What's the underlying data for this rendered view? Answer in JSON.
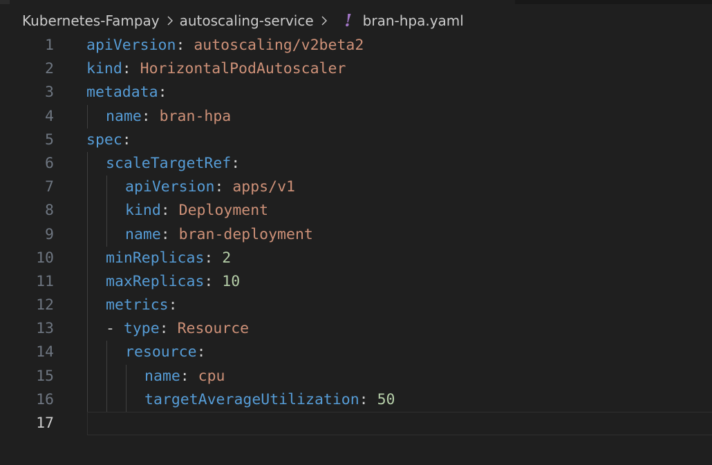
{
  "breadcrumb": {
    "folder": "Kubernetes-Fampay",
    "subfolder": "autoscaling-service",
    "file_icon": "yaml-exclamation-icon",
    "file_icon_glyph": "!",
    "file": "bran-hpa.yaml"
  },
  "editor": {
    "active_line": 17,
    "lines": [
      {
        "num": "1",
        "indent": 0,
        "tokens": [
          {
            "t": "k",
            "v": "apiVersion"
          },
          {
            "t": "p",
            "v": ": "
          },
          {
            "t": "s",
            "v": "autoscaling/v2beta2"
          }
        ]
      },
      {
        "num": "2",
        "indent": 0,
        "tokens": [
          {
            "t": "k",
            "v": "kind"
          },
          {
            "t": "p",
            "v": ": "
          },
          {
            "t": "s",
            "v": "HorizontalPodAutoscaler"
          }
        ]
      },
      {
        "num": "3",
        "indent": 0,
        "tokens": [
          {
            "t": "k",
            "v": "metadata"
          },
          {
            "t": "p",
            "v": ":"
          }
        ]
      },
      {
        "num": "4",
        "indent": 1,
        "tokens": [
          {
            "t": "k",
            "v": "name"
          },
          {
            "t": "p",
            "v": ": "
          },
          {
            "t": "s",
            "v": "bran-hpa"
          }
        ]
      },
      {
        "num": "5",
        "indent": 0,
        "tokens": [
          {
            "t": "k",
            "v": "spec"
          },
          {
            "t": "p",
            "v": ":"
          }
        ]
      },
      {
        "num": "6",
        "indent": 1,
        "tokens": [
          {
            "t": "k",
            "v": "scaleTargetRef"
          },
          {
            "t": "p",
            "v": ":"
          }
        ]
      },
      {
        "num": "7",
        "indent": 2,
        "tokens": [
          {
            "t": "k",
            "v": "apiVersion"
          },
          {
            "t": "p",
            "v": ": "
          },
          {
            "t": "s",
            "v": "apps/v1"
          }
        ]
      },
      {
        "num": "8",
        "indent": 2,
        "tokens": [
          {
            "t": "k",
            "v": "kind"
          },
          {
            "t": "p",
            "v": ": "
          },
          {
            "t": "s",
            "v": "Deployment"
          }
        ]
      },
      {
        "num": "9",
        "indent": 2,
        "tokens": [
          {
            "t": "k",
            "v": "name"
          },
          {
            "t": "p",
            "v": ": "
          },
          {
            "t": "s",
            "v": "bran-deployment"
          }
        ]
      },
      {
        "num": "10",
        "indent": 1,
        "tokens": [
          {
            "t": "k",
            "v": "minReplicas"
          },
          {
            "t": "p",
            "v": ": "
          },
          {
            "t": "n",
            "v": "2"
          }
        ]
      },
      {
        "num": "11",
        "indent": 1,
        "tokens": [
          {
            "t": "k",
            "v": "maxReplicas"
          },
          {
            "t": "p",
            "v": ": "
          },
          {
            "t": "n",
            "v": "10"
          }
        ]
      },
      {
        "num": "12",
        "indent": 1,
        "tokens": [
          {
            "t": "k",
            "v": "metrics"
          },
          {
            "t": "p",
            "v": ":"
          }
        ]
      },
      {
        "num": "13",
        "indent": 1,
        "tokens": [
          {
            "t": "p",
            "v": "- "
          },
          {
            "t": "k",
            "v": "type"
          },
          {
            "t": "p",
            "v": ": "
          },
          {
            "t": "s",
            "v": "Resource"
          }
        ]
      },
      {
        "num": "14",
        "indent": 2,
        "tokens": [
          {
            "t": "k",
            "v": "resource"
          },
          {
            "t": "p",
            "v": ":"
          }
        ]
      },
      {
        "num": "15",
        "indent": 3,
        "tokens": [
          {
            "t": "k",
            "v": "name"
          },
          {
            "t": "p",
            "v": ": "
          },
          {
            "t": "s",
            "v": "cpu"
          }
        ]
      },
      {
        "num": "16",
        "indent": 3,
        "tokens": [
          {
            "t": "k",
            "v": "targetAverageUtilization"
          },
          {
            "t": "p",
            "v": ": "
          },
          {
            "t": "n",
            "v": "50"
          }
        ]
      },
      {
        "num": "17",
        "indent": 0,
        "tokens": []
      }
    ]
  },
  "colors": {
    "background": "#1f1f1f",
    "key": "#569cd6",
    "string": "#ce9178",
    "number": "#b5cea8",
    "punctuation": "#cccccc",
    "line_number": "#6e7681",
    "line_number_active": "#cccccc",
    "yaml_icon": "#a074c4"
  }
}
